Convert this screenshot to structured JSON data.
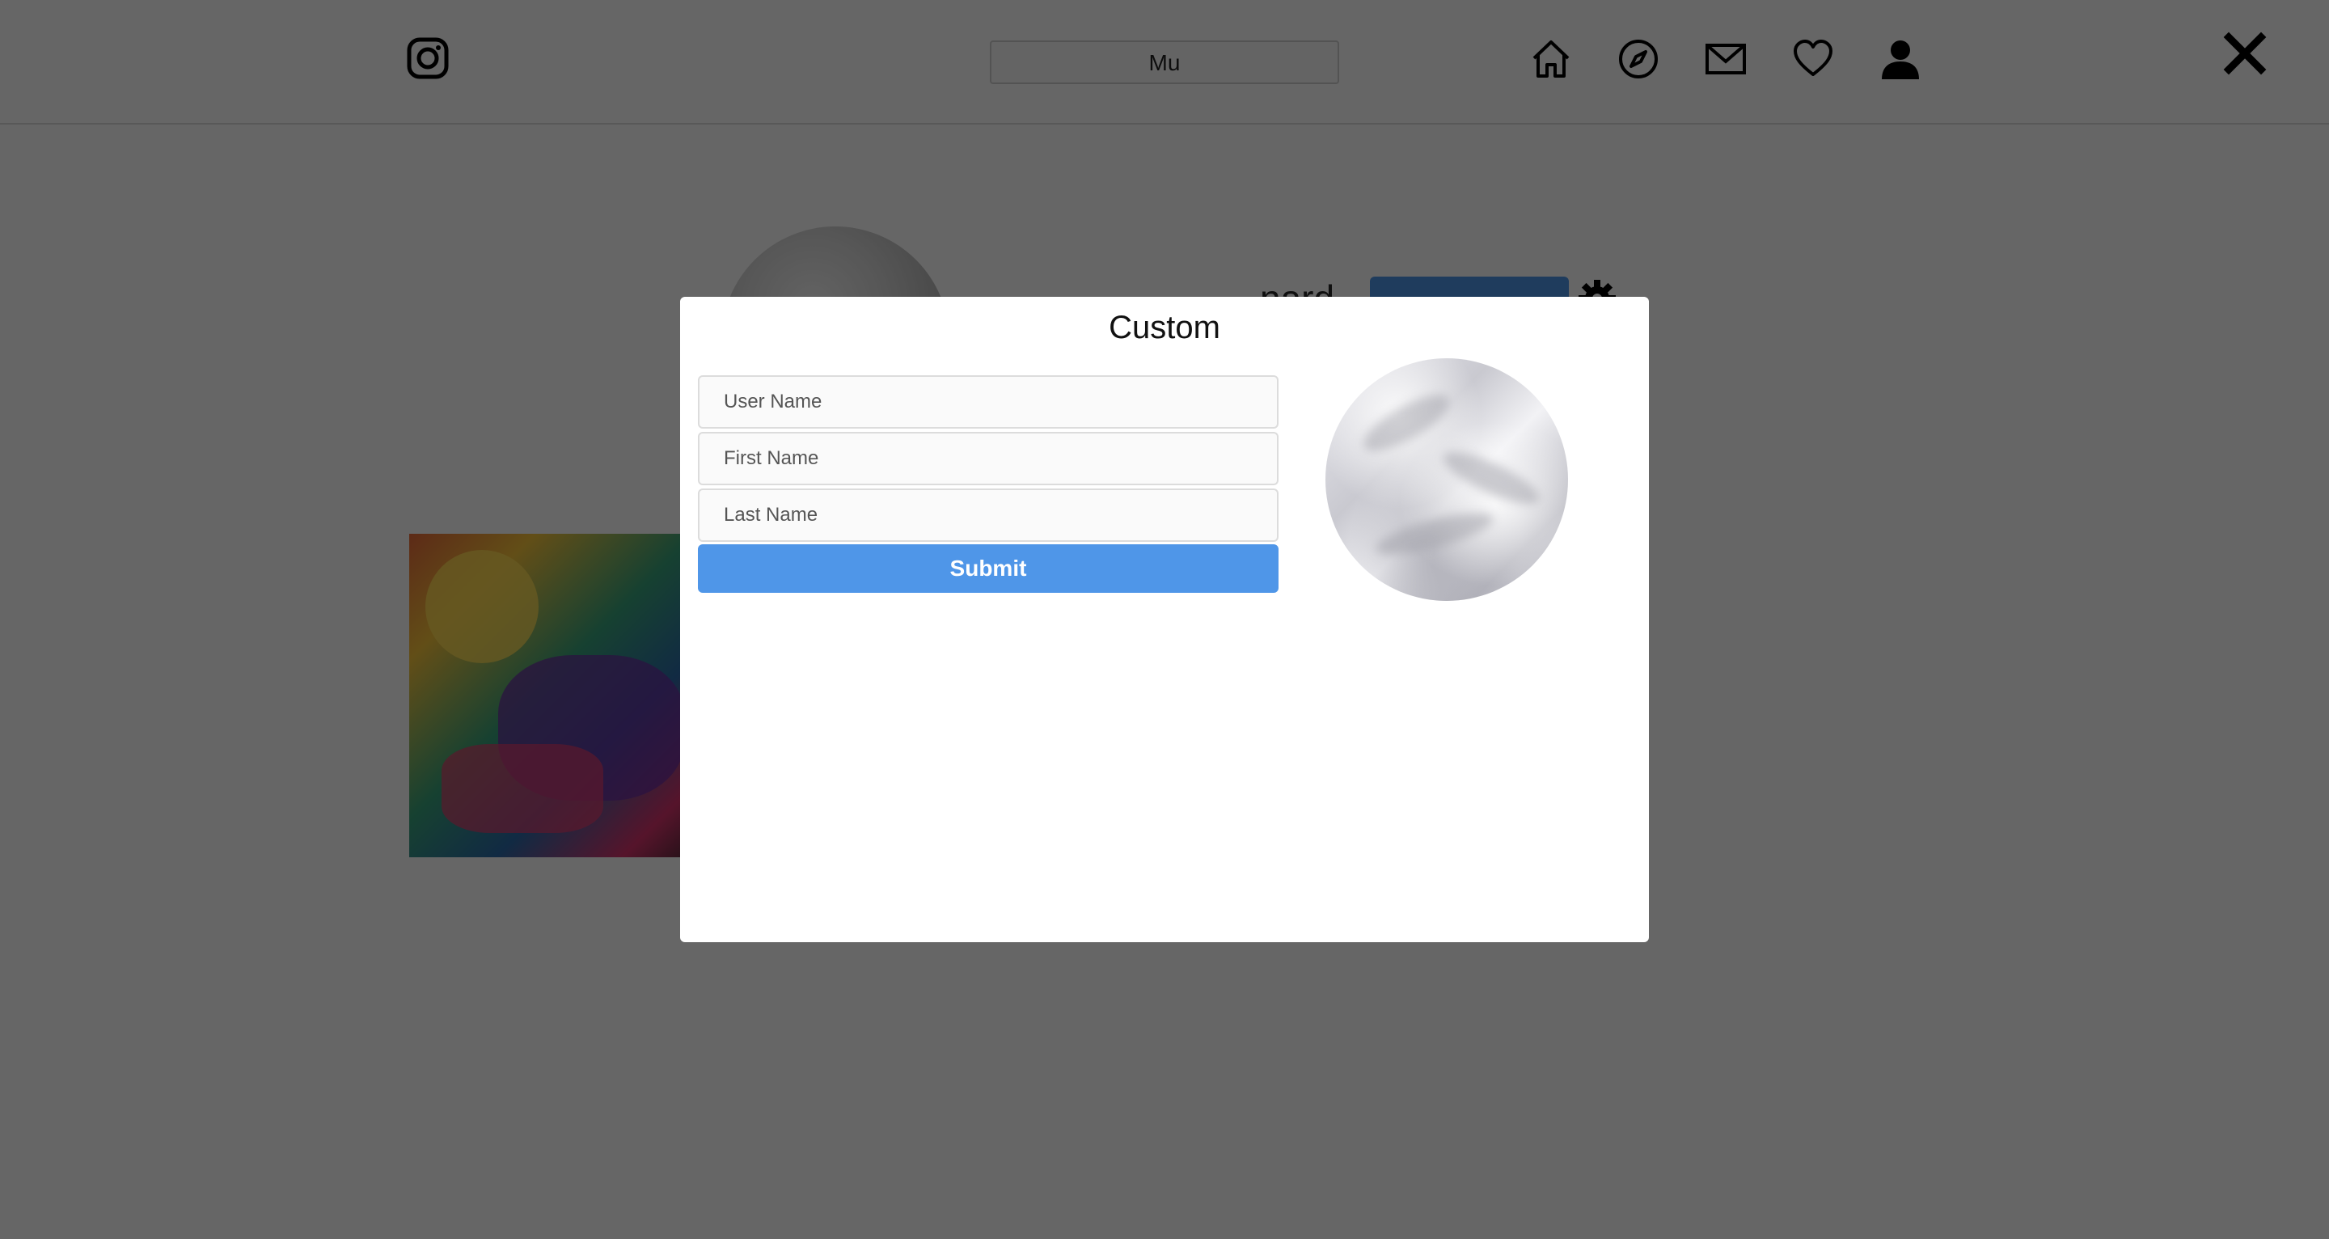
{
  "nav": {
    "search_value": "Mu",
    "icons": [
      "instagram-icon",
      "home-icon",
      "explore-icon",
      "mail-icon",
      "heart-icon",
      "user-icon"
    ]
  },
  "profile": {
    "username_partial": "nard"
  },
  "modal": {
    "title": "Custom",
    "fields": {
      "username_placeholder": "User Name",
      "firstname_placeholder": "First Name",
      "lastname_placeholder": "Last Name"
    },
    "submit_label": "Submit"
  },
  "colors": {
    "accent": "#4f96e8",
    "overlay": "rgba(0,0,0,0.6)"
  }
}
